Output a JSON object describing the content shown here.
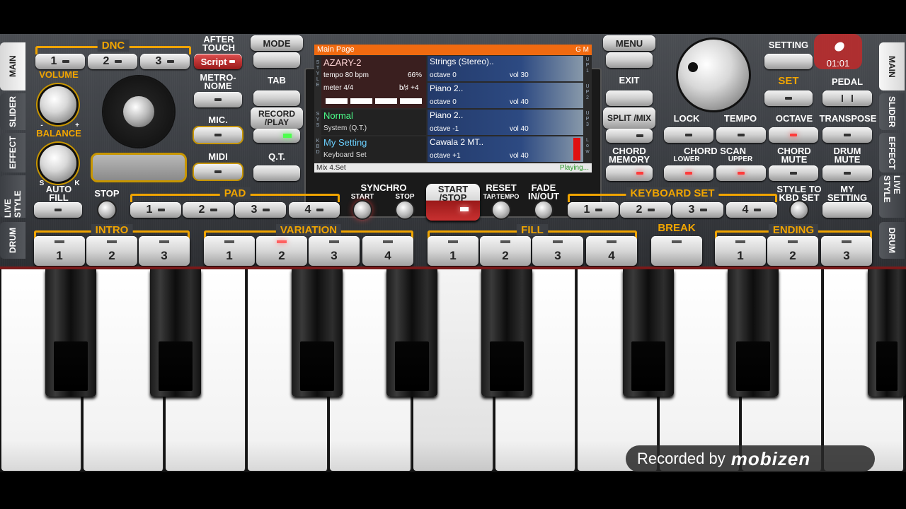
{
  "display": {
    "page_title": "Main Page",
    "gm": "G M",
    "style_name": "AZARY-2",
    "tempo": "tempo 80 bpm",
    "percent": "66%",
    "meter": "meter 4/4",
    "transpose": "b/♯ +4",
    "sys_name": "Normal",
    "sys_sub": "System (Q.T.)",
    "kbd_name": "My Setting",
    "kbd_sub": "Keyboard Set",
    "parts": [
      {
        "name": "Strings (Stereo)..",
        "octave": "octave 0",
        "vol": "vol 30",
        "tag": "U P 1"
      },
      {
        "name": "Piano 2..",
        "octave": "octave 0",
        "vol": "vol 40",
        "tag": "U P 2"
      },
      {
        "name": "Piano 2..",
        "octave": "octave -1",
        "vol": "vol 40",
        "tag": "U P 3"
      },
      {
        "name": "Cawala 2 MT..",
        "octave": "octave +1",
        "vol": "vol 40",
        "tag": "L o w"
      }
    ],
    "side_labels": {
      "style": "S T Y L E",
      "sys": "S Y S",
      "kbd": "K B D"
    },
    "status_left": "Mix 4.Set",
    "status_right": "Playing..."
  },
  "left_tabs": [
    "MAIN",
    "SLIDER",
    "EFFECT",
    "LIVE STYLE",
    "DRUM"
  ],
  "right_tabs": [
    "MAIN",
    "SLIDER",
    "EFFECT",
    "LIVE STYLE",
    "DRUM"
  ],
  "labels": {
    "dnc": "DNC",
    "after_touch": "AFTER TOUCH",
    "script": "Script",
    "volume": "VOLUME",
    "balance": "BALANCE",
    "metronome": "METRO- NOME",
    "mic": "MIC.",
    "midi": "MIDI",
    "mode": "MODE",
    "tab": "TAB",
    "record_play": "RECORD /PLAY",
    "qt": "Q.T.",
    "menu": "MENU",
    "exit": "EXIT",
    "split_mix": "SPLIT /MIX",
    "chord_memory": "CHORD MEMORY",
    "setting": "SETTING",
    "timer": "01:01",
    "set": "SET",
    "pedal": "PEDAL",
    "lock": "LOCK",
    "tempo": "TEMPO",
    "octave": "OCTAVE",
    "transpose": "TRANSPOSE",
    "chord_scan": "CHORD SCAN",
    "lower": "LOWER",
    "upper": "UPPER",
    "chord_mute": "CHORD MUTE",
    "drum_mute": "DRUM MUTE",
    "auto_fill": "AUTO FILL",
    "stop": "STOP",
    "pad": "PAD",
    "synchro": "SYNCHRO",
    "start_small": "START",
    "stop_small": "STOP",
    "start_stop": "START /STOP",
    "reset": "RESET",
    "tap_tempo": "TAP.TEMPO",
    "fade": "FADE IN/OUT",
    "keyboard_set": "KEYBOARD SET",
    "style_to_kbd": "STYLE TO KBD SET",
    "my_setting": "MY SETTING",
    "intro": "INTRO",
    "variation": "VARIATION",
    "fill": "FILL",
    "break": "BREAK",
    "ending": "ENDING",
    "minus": "-",
    "plus": "+",
    "s": "S",
    "k": "K"
  },
  "nums": [
    "1",
    "2",
    "3",
    "4"
  ],
  "watermark": {
    "text": "Recorded by",
    "brand": "mobizen"
  }
}
